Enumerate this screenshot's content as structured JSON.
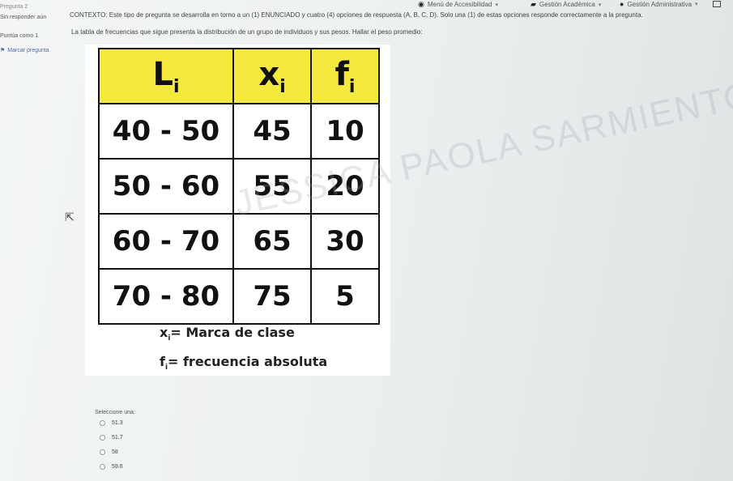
{
  "topnav": {
    "accessibility": "Menú de Accesibilidad",
    "academic": "Gestión Académica",
    "admin": "Gestión Administrativa"
  },
  "sidebar": {
    "pregunta": "Pregunta 2",
    "estado": "Sin responder aún",
    "puntua": "Puntúa como 1",
    "marcar": "Marcar pregunta"
  },
  "question": {
    "context": "CONTEXTO: Este tipo de pregunta se desarrolla en torno a un (1) ENUNCIADO y cuatro (4) opciones de respuesta (A, B, C, D). Solo una (1) de estas opciones responde correctamente a la pregunta.",
    "prompt": "La tabla de frecuencias que sigue presenta la distribución de un grupo de individuos y sus pesos. Hallar el peso promedio:"
  },
  "table": {
    "headers": [
      {
        "main": "L",
        "sub": "i"
      },
      {
        "main": "x",
        "sub": "i"
      },
      {
        "main": "f",
        "sub": "i"
      }
    ],
    "rows": [
      [
        "40 - 50",
        "45",
        "10"
      ],
      [
        "50 - 60",
        "55",
        "20"
      ],
      [
        "60 - 70",
        "65",
        "30"
      ],
      [
        "70 - 80",
        "75",
        "5"
      ]
    ]
  },
  "legend": {
    "x_sym": "x",
    "x_sub": "i",
    "x_text": "= Marca de clase",
    "f_sym": "f",
    "f_sub": "i",
    "f_text": "= frecuencia absoluta"
  },
  "watermark": "JESSICA PAOLA SARMIENTO GALEANO",
  "answers": {
    "label": "Seleccione una:",
    "options": [
      "51.3",
      "51.7",
      "58",
      "59.6"
    ]
  }
}
